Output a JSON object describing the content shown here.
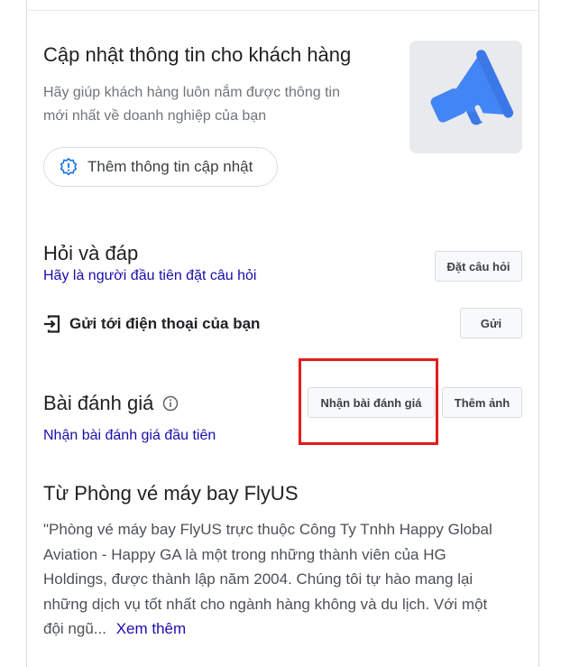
{
  "update_section": {
    "title": "Cập nhật thông tin cho khách hàng",
    "description_line1": "Hãy giúp khách hàng luôn nắm được thông tin",
    "description_line2": "mới nhất về doanh nghiệp của bạn",
    "add_update_label": "Thêm thông tin cập nhật",
    "icon": "megaphone-icon",
    "accent_color": "#4285f4"
  },
  "qa_section": {
    "title": "Hỏi và đáp",
    "first_question_link": "Hãy là người đầu tiên đặt câu hỏi",
    "ask_button": "Đặt câu hỏi"
  },
  "send_phone": {
    "label": "Gửi tới điện thoại của bạn",
    "send_button": "Gửi"
  },
  "reviews": {
    "title": "Bài đánh giá",
    "get_reviews_button": "Nhận bài đánh giá",
    "add_photo_button": "Thêm ảnh",
    "first_review_link": "Nhận bài đánh giá đầu tiên",
    "highlight_color": "#e11b1b"
  },
  "from_business": {
    "title": "Từ Phòng vé máy bay FlyUS",
    "line1": "\"Phòng vé máy bay FlyUS trực thuộc Công Ty Tnhh Happy Global",
    "line2": "Aviation - Happy GA là một trong những thành viên của HG",
    "line3": "Holdings, được thành lập năm 2004. Chúng tôi tự hào mang lại",
    "line4": "những dịch vụ tốt nhất cho ngành hàng không và du lịch. Với một",
    "line5_prefix": "đội ngũ...",
    "see_more": "Xem thêm"
  }
}
